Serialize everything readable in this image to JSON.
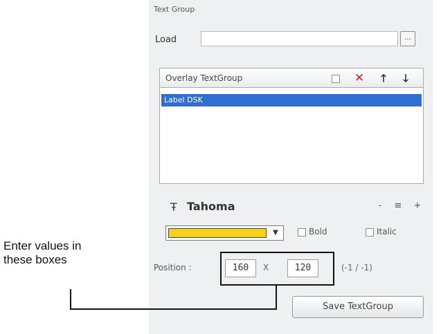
{
  "panel": {
    "group_title": "Text Group",
    "load_label": "Load",
    "load_value": "",
    "browse_label": "...",
    "overlay_label": "Overlay TextGroup",
    "list_items": [
      "Label DSK"
    ],
    "font_name": "Tahoma",
    "font_icon": "font-icon",
    "font_buttons": {
      "minus": "-",
      "mid": "≡",
      "plus": "+"
    },
    "color": "#f7d21a",
    "bold_label": "Bold",
    "italic_label": "Italic",
    "position_label": "Position :",
    "x_value": "160",
    "x_separator": "X",
    "y_value": "120",
    "position_hint": "(-1 / -1)",
    "save_label": "Save TextGroup"
  },
  "annotation": {
    "callout_line1": "Enter values in",
    "callout_line2": "these boxes"
  }
}
